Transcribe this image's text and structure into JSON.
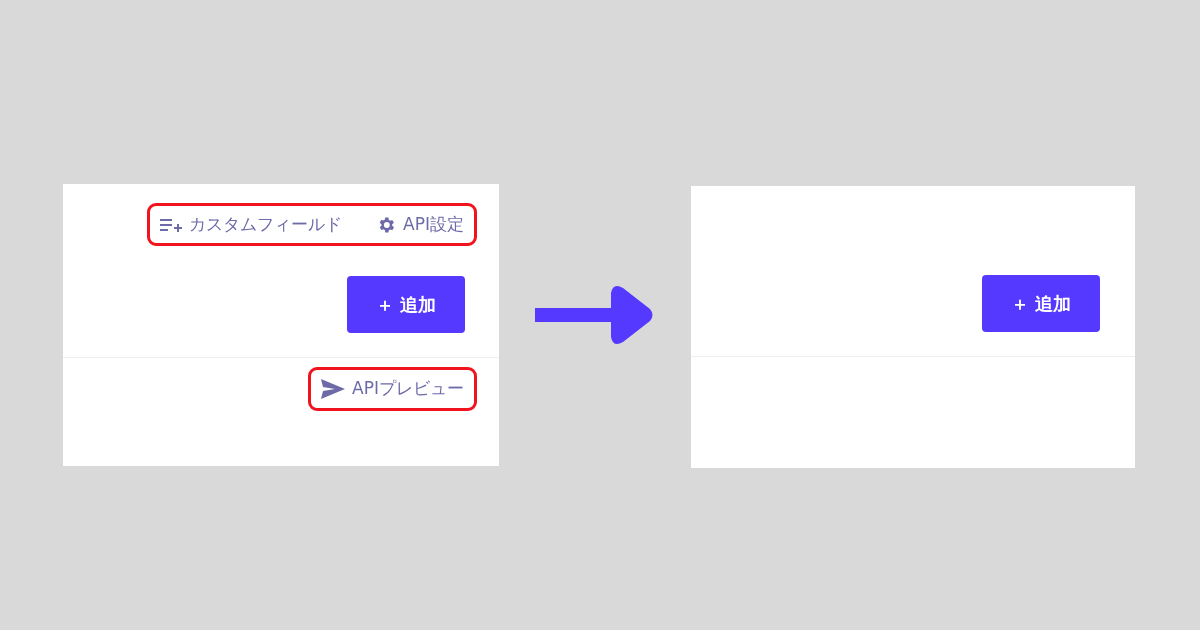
{
  "before": {
    "toolbar": {
      "highlighted": true,
      "links": [
        {
          "kind": "custom-fields",
          "label": "カスタムフィールド"
        },
        {
          "kind": "settings",
          "label": "API設定"
        }
      ]
    },
    "add_button": {
      "label": "＋ 追加"
    },
    "preview": {
      "highlighted": true,
      "link": {
        "kind": "send",
        "label": "APIプレビュー"
      }
    }
  },
  "after": {
    "add_button": {
      "label": "＋ 追加"
    }
  }
}
